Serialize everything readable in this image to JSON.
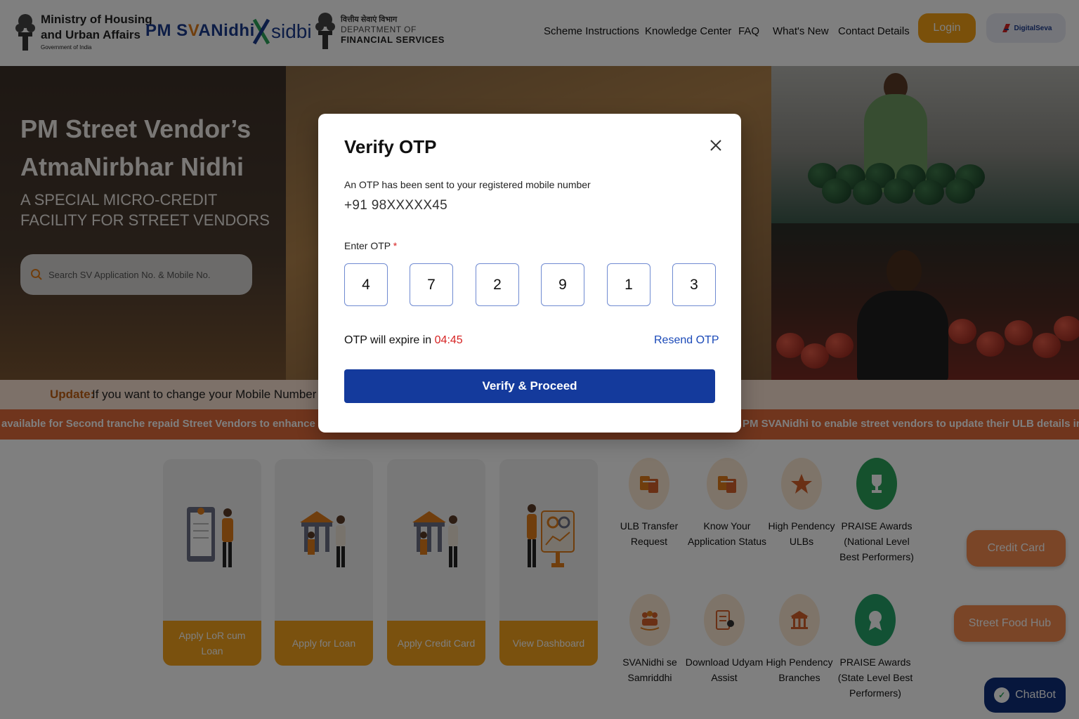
{
  "header": {
    "ministry_line1": "Ministry of Housing",
    "ministry_line2": "and Urban Affairs",
    "ministry_sub": "Government of India",
    "pmsv_prefix": "PM S",
    "pmsv_accent": "V",
    "pmsv_suffix": "ANidhi",
    "sidbi": "sidbi",
    "dfs_hindi": "वित्तीय सेवाएं विभाग",
    "dfs_line1": "DEPARTMENT OF",
    "dfs_line2": "FINANCIAL SERVICES",
    "nav": [
      "Scheme Instructions",
      "Knowledge Center",
      "FAQ",
      "What's New",
      "Contact Details"
    ],
    "login": "Login",
    "digital_seva": "DigitalSeva"
  },
  "hero": {
    "title_line1": "PM Street Vendor’s",
    "title_line2": "AtmaNirbhar Nidhi",
    "subtitle": "A SPECIAL MICRO-CREDIT FACILITY FOR STREET VENDORS",
    "search_placeholder": "Search SV Application No. & Mobile No."
  },
  "update": {
    "label": "Update:",
    "text": "If you want to change your Mobile Number , Plea"
  },
  "ticker": {
    "left": "available for Second tranche repaid Street Vendors to enhance their wor",
    "right": "PM SVANidhi to enable street vendors to update their ULB details in case"
  },
  "cards": [
    {
      "label": "Apply LoR cum Loan"
    },
    {
      "label": "Apply for Loan"
    },
    {
      "label": "Apply Credit Card"
    },
    {
      "label": "View Dashboard"
    }
  ],
  "services": [
    {
      "label": "ULB Transfer Request",
      "icon": "transfer-icon"
    },
    {
      "label": "Know Your Application Status",
      "icon": "status-icon"
    },
    {
      "label": "High Pendency ULBs",
      "icon": "star-icon"
    },
    {
      "label": "PRAISE Awards (National Level Best Performers)",
      "icon": "trophy-icon"
    },
    {
      "label": "SVANidhi se Samriddhi",
      "icon": "group-icon"
    },
    {
      "label": "Download Udyam Assist",
      "icon": "document-icon"
    },
    {
      "label": "High Pendency Branches",
      "icon": "bank-icon"
    },
    {
      "label": "PRAISE Awards (State Level Best Performers)",
      "icon": "award-icon"
    }
  ],
  "side": {
    "credit_card": "Credit Card",
    "street_food_hub": "Street Food Hub",
    "chatbot": "ChatBot"
  },
  "modal": {
    "title": "Verify OTP",
    "message": "An OTP has been sent to your registered mobile number",
    "phone": "+91 98XXXXX45",
    "otp_label": "Enter OTP",
    "required_mark": "*",
    "otp_digits": [
      "4",
      "7",
      "2",
      "9",
      "1",
      "3"
    ],
    "expire_text": "OTP will expire in",
    "expire_time": "04:45",
    "resend": "Resend OTP",
    "verify_button": "Verify & Proceed"
  },
  "colors": {
    "accent_orange": "#f4a114",
    "primary_blue": "#143a9c",
    "ticker_orange": "#e06a3a",
    "error_red": "#d62222",
    "link_blue": "#1a49b8"
  }
}
